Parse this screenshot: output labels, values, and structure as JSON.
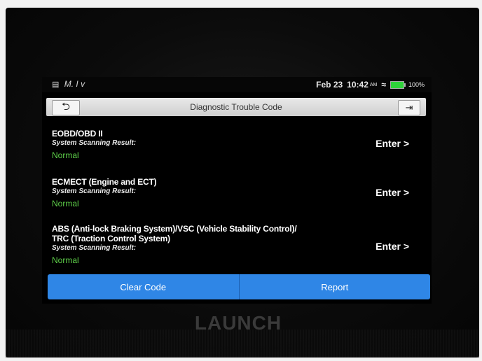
{
  "status_bar": {
    "left_text": "M. I v",
    "date": "Feb 23",
    "time": "10:42",
    "time_suffix": "AM",
    "battery": "100%"
  },
  "header": {
    "title": "Diagnostic Trouble Code",
    "back_glyph": "⮌",
    "exit_glyph": "⇥"
  },
  "systems": [
    {
      "name_lines": [
        "EOBD/OBD II"
      ],
      "scan_label": "System Scanning Result:",
      "result": "Normal",
      "action": "Enter >"
    },
    {
      "name_lines": [
        "ECMECT (Engine and ECT)"
      ],
      "scan_label": "System Scanning Result:",
      "result": "Normal",
      "action": "Enter >"
    },
    {
      "name_lines": [
        "ABS (Anti-lock Braking System)/VSC (Vehicle Stability Control)/",
        "TRC (Traction Control System)"
      ],
      "scan_label": "System Scanning Result:",
      "result": "Normal",
      "action": "Enter >"
    }
  ],
  "bottom_bar": {
    "clear_code_label": "Clear Code",
    "report_label": "Report"
  },
  "device": {
    "brand": "LAUNCH"
  },
  "colors": {
    "accent": "#2f86e6",
    "status_ok": "#5fd24a",
    "screen_bg": "#000000"
  }
}
